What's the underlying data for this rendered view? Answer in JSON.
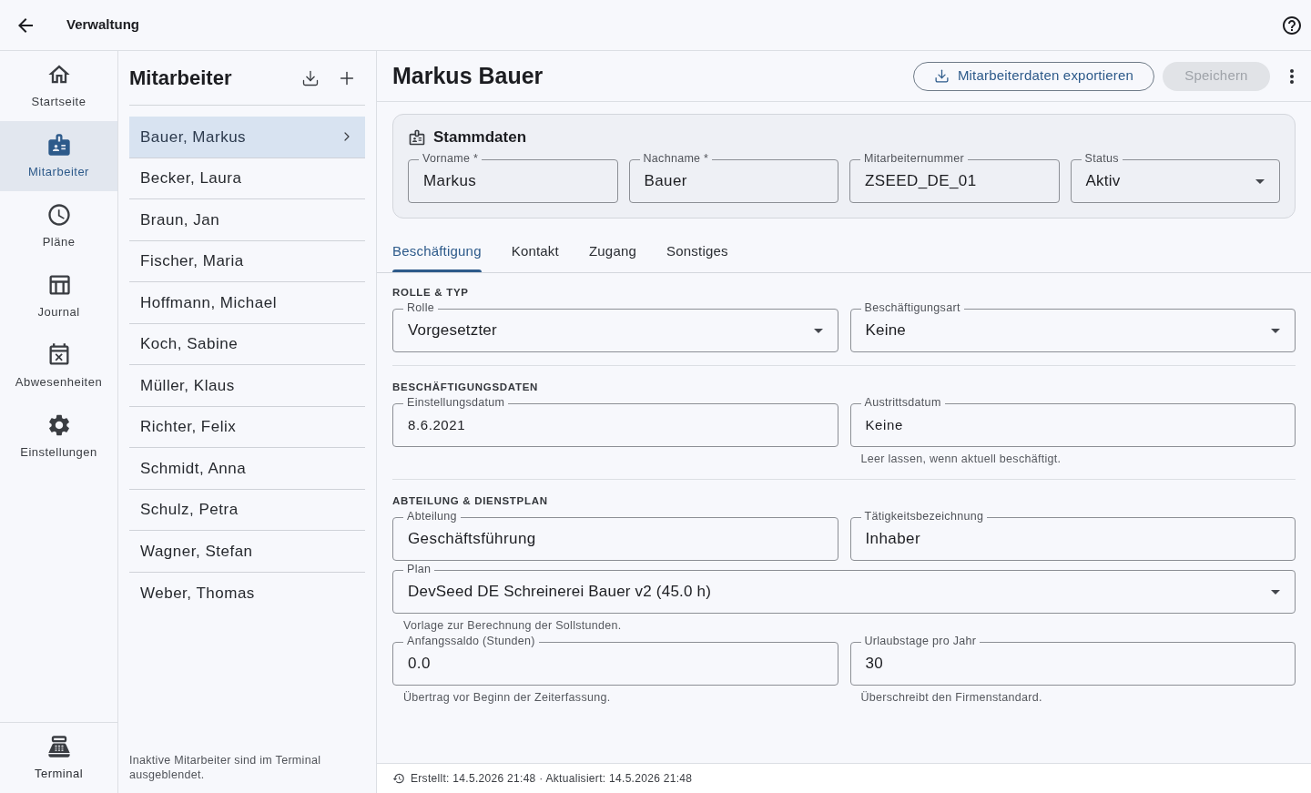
{
  "app_bar": {
    "title": "Verwaltung"
  },
  "nav": {
    "items": [
      {
        "label": "Startseite",
        "selected": false
      },
      {
        "label": "Mitarbeiter",
        "selected": true
      },
      {
        "label": "Pläne",
        "selected": false
      },
      {
        "label": "Journal",
        "selected": false
      },
      {
        "label": "Abwesenheiten",
        "selected": false
      },
      {
        "label": "Einstellungen",
        "selected": false
      }
    ],
    "bottom_item": {
      "label": "Terminal"
    }
  },
  "employee_list": {
    "title": "Mitarbeiter",
    "items": [
      {
        "name": "Bauer, Markus",
        "selected": true
      },
      {
        "name": "Becker, Laura",
        "selected": false
      },
      {
        "name": "Braun, Jan",
        "selected": false
      },
      {
        "name": "Fischer, Maria",
        "selected": false
      },
      {
        "name": "Hoffmann, Michael",
        "selected": false
      },
      {
        "name": "Koch, Sabine",
        "selected": false
      },
      {
        "name": "Müller, Klaus",
        "selected": false
      },
      {
        "name": "Richter, Felix",
        "selected": false
      },
      {
        "name": "Schmidt, Anna",
        "selected": false
      },
      {
        "name": "Schulz, Petra",
        "selected": false
      },
      {
        "name": "Wagner, Stefan",
        "selected": false
      },
      {
        "name": "Weber, Thomas",
        "selected": false
      }
    ],
    "note": "Inaktive Mitarbeiter sind im Terminal ausgeblendet."
  },
  "detail": {
    "title": "Markus Bauer",
    "export_button": {
      "label": "Mitarbeiterdaten exportieren"
    },
    "save_button": {
      "label": "Speichern",
      "disabled": true
    },
    "master_data": {
      "title": "Stammdaten",
      "fields": [
        {
          "label": "Vorname *",
          "value": "Markus",
          "kind": "text"
        },
        {
          "label": "Nachname *",
          "value": "Bauer",
          "kind": "text"
        },
        {
          "label": "Mitarbeiternummer",
          "value": "ZSEED_DE_01",
          "kind": "text"
        },
        {
          "label": "Status",
          "value": "Aktiv",
          "kind": "select"
        }
      ]
    },
    "tabs": [
      {
        "label": "Beschäftigung",
        "selected": true
      },
      {
        "label": "Kontakt",
        "selected": false
      },
      {
        "label": "Zugang",
        "selected": false
      },
      {
        "label": "Sonstiges",
        "selected": false
      }
    ],
    "sections": [
      {
        "heading": "ROLLE & TYP",
        "rows": [
          {
            "fields": [
              {
                "label": "Rolle",
                "value": "Vorgesetzter",
                "kind": "select"
              },
              {
                "label": "Beschäftigungsart",
                "value": "Keine",
                "kind": "select"
              }
            ]
          }
        ]
      },
      {
        "heading": "BESCHÄFTIGUNGSDATEN",
        "rows": [
          {
            "fields": [
              {
                "label": "Einstellungsdatum",
                "value": "8.6.2021",
                "kind": "date"
              },
              {
                "label": "Austrittsdatum",
                "value": "Keine",
                "kind": "date",
                "helper": "Leer lassen, wenn aktuell beschäftigt."
              }
            ]
          }
        ]
      },
      {
        "heading": "ABTEILUNG & DIENSTPLAN",
        "rows": [
          {
            "fields": [
              {
                "label": "Abteilung",
                "value": "Geschäftsführung",
                "kind": "text"
              },
              {
                "label": "Tätigkeitsbezeichnung",
                "value": "Inhaber",
                "kind": "text"
              }
            ]
          },
          {
            "fields": [
              {
                "label": "Plan",
                "value": "DevSeed DE Schreinerei Bauer v2 (45.0 h)",
                "kind": "select",
                "helper": "Vorlage zur Berechnung der Sollstunden."
              }
            ]
          },
          {
            "fields": [
              {
                "label": "Anfangssaldo (Stunden)",
                "value": "0.0",
                "kind": "text",
                "helper": "Übertrag vor Beginn der Zeiterfassung."
              },
              {
                "label": "Urlaubstage pro Jahr",
                "value": "30",
                "kind": "text",
                "helper": "Überschreibt den Firmenstandard."
              }
            ]
          }
        ]
      }
    ],
    "status_bar": {
      "text": "Erstellt: 14.5.2026 21:48 · Aktualisiert: 14.5.2026 21:48"
    }
  }
}
